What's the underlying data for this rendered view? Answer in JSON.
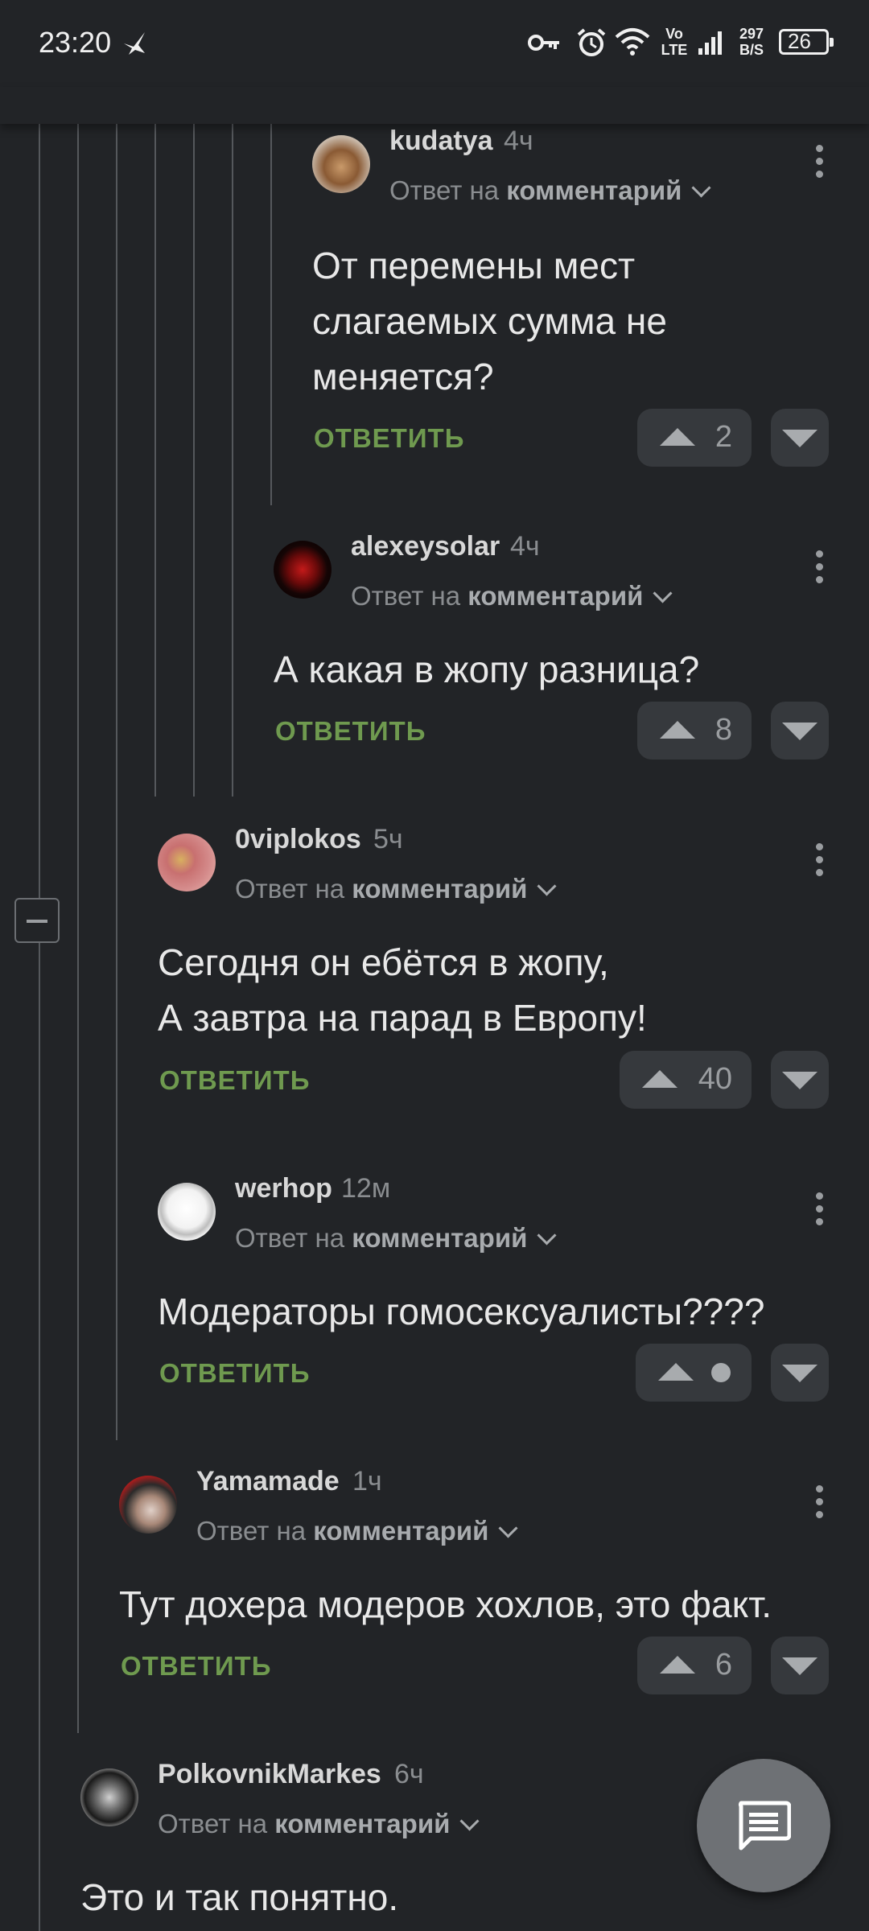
{
  "status_bar": {
    "time": "23:20",
    "net_speed_value": "297",
    "net_speed_unit": "B/S",
    "volte_top": "Vo",
    "volte_bottom": "LTE",
    "battery": "26",
    "icons": [
      "bird-notification-icon",
      "vpn-key-icon",
      "alarm-icon",
      "wifi-icon",
      "volte-icon",
      "signal-icon",
      "battery-icon"
    ]
  },
  "reply_label": "ОТВЕТИТЬ",
  "reply_to_prefix": "Ответ на",
  "reply_to_link": "комментарий",
  "comments": [
    {
      "user": "kudatya",
      "time": "4ч",
      "lines": [
        "От перемены мест",
        "слагаемых сумма не",
        "меняется?"
      ],
      "votes": "2"
    },
    {
      "user": "alexeysolar",
      "time": "4ч",
      "lines": [
        "А какая в жопу разница?"
      ],
      "votes": "8"
    },
    {
      "user": "0viplokos",
      "time": "5ч",
      "lines": [
        "Сегодня он ебётся в жопу,",
        "А завтра на парад в Европу!"
      ],
      "votes": "40"
    },
    {
      "user": "werhop",
      "time": "12м",
      "lines": [
        "Модераторы гомосексуалисты????"
      ],
      "votes": ""
    },
    {
      "user": "Yamamade",
      "time": "1ч",
      "lines": [
        "Тут дохера модеров хохлов, это факт."
      ],
      "votes": "6"
    },
    {
      "user": "PolkovnikMarkes",
      "time": "6ч",
      "lines": [
        "Это и так понятно."
      ],
      "votes": ""
    }
  ],
  "colors": {
    "background": "#222427",
    "reply_green": "#6f9a4f",
    "vote_bg": "#36393d",
    "thread_line": "#55585c"
  },
  "fab_icon": "comment-icon"
}
